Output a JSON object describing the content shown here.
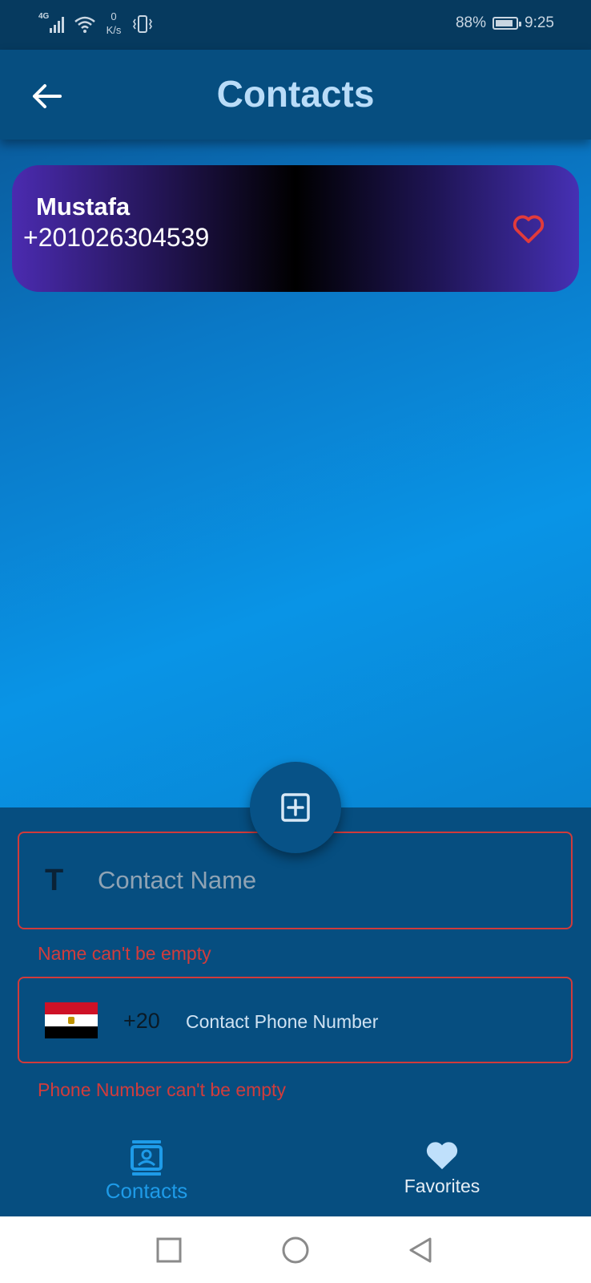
{
  "status_bar": {
    "network_type": "4G",
    "net_speed_value": "0",
    "net_speed_unit": "K/s",
    "battery_percent": "88%",
    "battery_level": 0.88,
    "time": "9:25"
  },
  "app_bar": {
    "title": "Contacts",
    "back_icon": "arrow-left-icon"
  },
  "contacts": [
    {
      "name": "Mustafa",
      "phone": "+201026304539",
      "favorite_icon": "heart-outline-icon"
    }
  ],
  "form": {
    "add_icon": "plus-square-icon",
    "name_field": {
      "type_icon_text": "T",
      "placeholder": "Contact Name",
      "value": "",
      "error": "Name can't be empty"
    },
    "phone_field": {
      "flag_icon": "egypt-flag-icon",
      "dial_code": "+20",
      "placeholder": "Contact Phone Number",
      "value": "",
      "error": "Phone Number can't be empty"
    }
  },
  "bottom_nav": {
    "items": [
      {
        "label": "Contacts",
        "icon": "contacts-icon",
        "active": true
      },
      {
        "label": "Favorites",
        "icon": "heart-icon",
        "active": false
      }
    ]
  },
  "system_nav": {
    "icons": [
      "recents-square-icon",
      "home-circle-icon",
      "back-triangle-icon"
    ]
  },
  "colors": {
    "app_bar": "#064e80",
    "title": "#b9dcf8",
    "error": "#d13c3c",
    "active_nav": "#1e9be8",
    "favorite_heart": "#e23b3b"
  }
}
